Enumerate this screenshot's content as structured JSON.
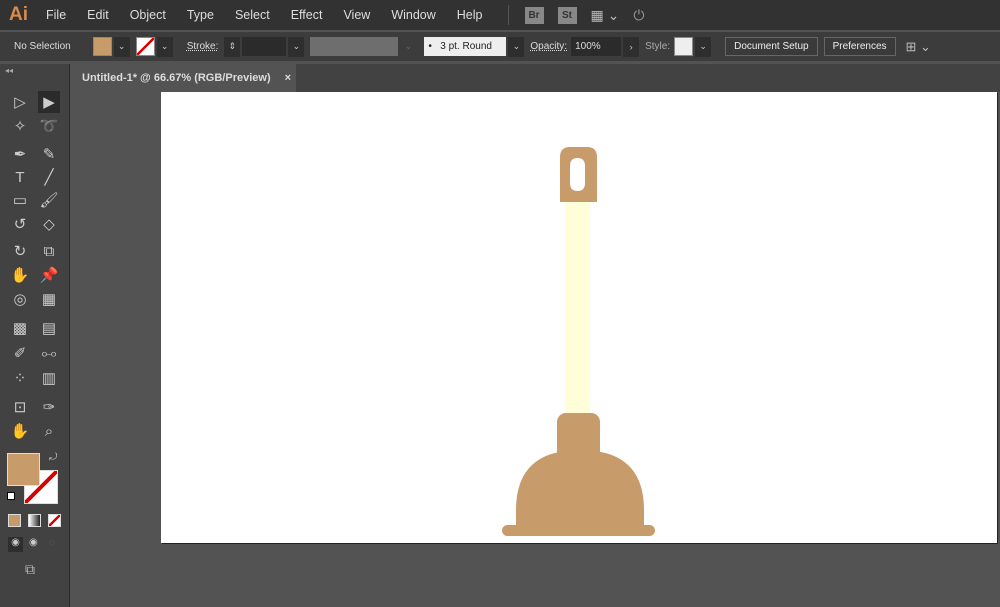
{
  "app": {
    "logo": "Ai"
  },
  "menu": [
    "File",
    "Edit",
    "Object",
    "Type",
    "Select",
    "Effect",
    "View",
    "Window",
    "Help"
  ],
  "menu_icons": [
    "Br",
    "St"
  ],
  "control": {
    "selection": "No Selection",
    "fill_color": "#c89b6a",
    "stroke_label": "Stroke:",
    "brush": "3 pt. Round",
    "opacity_label": "Opacity:",
    "opacity": "100%",
    "style_label": "Style:",
    "document_setup": "Document Setup",
    "preferences": "Preferences"
  },
  "document_tab": {
    "title": "Untitled-1* @ 66.67% (RGB/Preview)",
    "close": "×"
  },
  "tools": [
    [
      "selection",
      "▷"
    ],
    [
      "direct-selection",
      "▶"
    ],
    [
      "magic-wand",
      "✧"
    ],
    [
      "lasso",
      "➰"
    ],
    [
      "pen",
      "✒"
    ],
    [
      "curvature",
      "✎"
    ],
    [
      "type",
      "T"
    ],
    [
      "line",
      "╱"
    ],
    [
      "rectangle",
      "▭"
    ],
    [
      "paintbrush",
      "🖌"
    ],
    [
      "shaper",
      "↺"
    ],
    [
      "eraser",
      "◇"
    ],
    [
      "rotate",
      "↻"
    ],
    [
      "scale",
      "⧉"
    ],
    [
      "warp",
      "✋"
    ],
    [
      "puppet-warp",
      "📌"
    ],
    [
      "shape-builder",
      "◎"
    ],
    [
      "perspective",
      "▦"
    ],
    [
      "mesh",
      "▩"
    ],
    [
      "gradient",
      "▤"
    ],
    [
      "eyedropper",
      "✐"
    ],
    [
      "blend",
      "⧟"
    ],
    [
      "symbol-sprayer",
      "⁘"
    ],
    [
      "column-graph",
      "▥"
    ],
    [
      "artboard",
      "⊡"
    ],
    [
      "slice",
      "✑"
    ],
    [
      "hand",
      "✋"
    ],
    [
      "zoom",
      "⌕"
    ]
  ],
  "colors": {
    "plunger": "#c89b6a",
    "shaft": "#fffed8",
    "canvas": "#535353",
    "artboard": "#ffffff"
  }
}
